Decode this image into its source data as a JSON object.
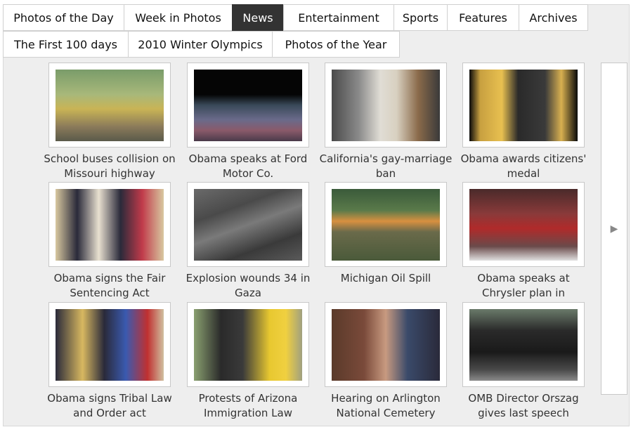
{
  "tabs": {
    "row1": [
      {
        "label": "Photos of the Day",
        "active": false
      },
      {
        "label": "Week in Photos",
        "active": false
      },
      {
        "label": "News",
        "active": true
      },
      {
        "label": "Entertainment",
        "active": false
      },
      {
        "label": "Sports",
        "active": false
      },
      {
        "label": "Features",
        "active": false
      },
      {
        "label": "Archives",
        "active": false
      }
    ],
    "row2": [
      {
        "label": "The First 100 days",
        "active": false
      },
      {
        "label": "2010 Winter Olympics",
        "active": false
      },
      {
        "label": "Photos of the Year",
        "active": false
      }
    ]
  },
  "items": [
    {
      "caption": "School buses collision on Missouri highway"
    },
    {
      "caption": "Obama speaks at Ford Motor Co."
    },
    {
      "caption": "California's gay-marriage ban"
    },
    {
      "caption": "Obama awards citizens' medal"
    },
    {
      "caption": "Obama signs the Fair Sentencing Act"
    },
    {
      "caption": "Explosion wounds 34 in Gaza"
    },
    {
      "caption": "Michigan Oil Spill"
    },
    {
      "caption": "Obama speaks at Chrysler plan in"
    },
    {
      "caption": "Obama signs Tribal Law and Order act"
    },
    {
      "caption": "Protests of Arizona Immigration Law"
    },
    {
      "caption": "Hearing on Arlington National Cemetery"
    },
    {
      "caption": "OMB Director Orszag gives last speech"
    }
  ],
  "next_arrow_icon": "chevron-right-icon",
  "colors": {
    "active_tab": "#333333",
    "panel_bg": "#eeeeee"
  }
}
